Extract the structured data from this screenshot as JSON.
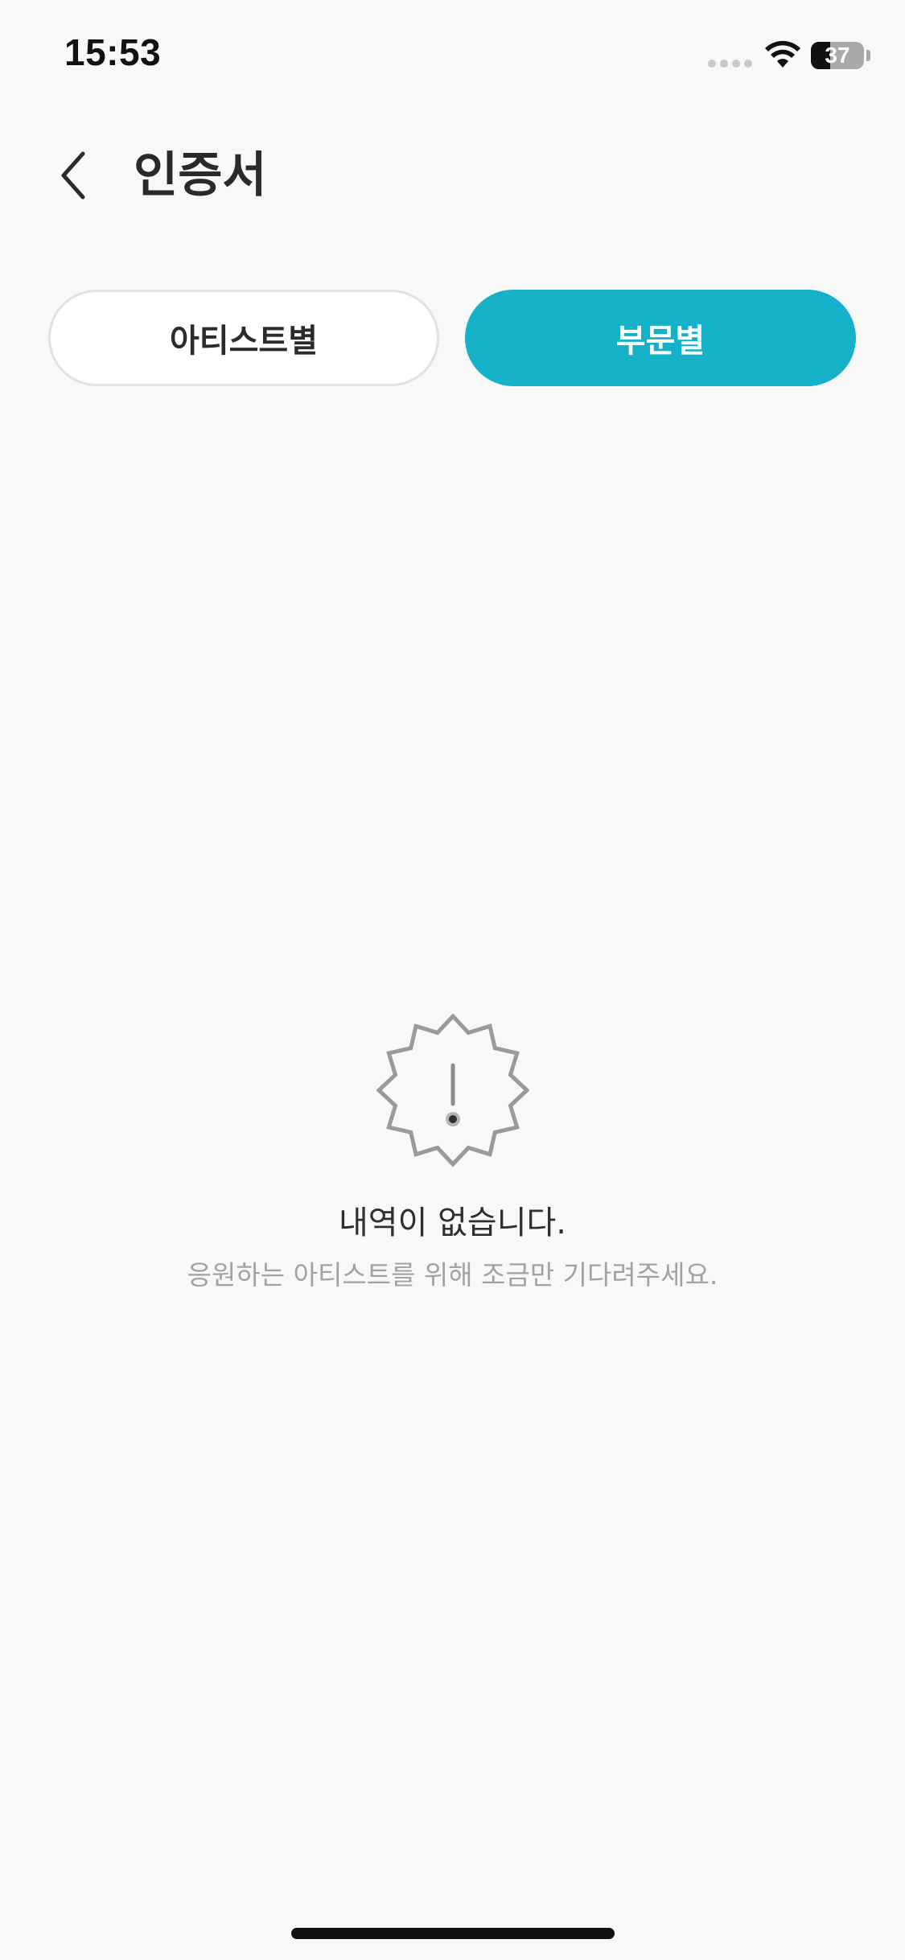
{
  "status_bar": {
    "time": "15:53",
    "battery_level": "37",
    "battery_fraction": 0.37,
    "icons": [
      "signal-dots-icon",
      "wifi-icon",
      "battery-icon"
    ]
  },
  "header": {
    "title": "인증서",
    "back_icon": "chevron-left-icon"
  },
  "tabs": [
    {
      "label": "아티스트별",
      "selected": false
    },
    {
      "label": "부문별",
      "selected": true
    }
  ],
  "empty_state": {
    "icon": "alert-badge-icon",
    "title": "내역이 없습니다.",
    "subtitle": "응원하는 아티스트를 위해 조금만 기다려주세요."
  },
  "colors": {
    "accent": "#14b1c9",
    "background": "#f8f8f8",
    "text_primary": "#2b2b2b",
    "text_secondary": "#a2a2a2",
    "icon_gray": "#9a9a9a"
  }
}
